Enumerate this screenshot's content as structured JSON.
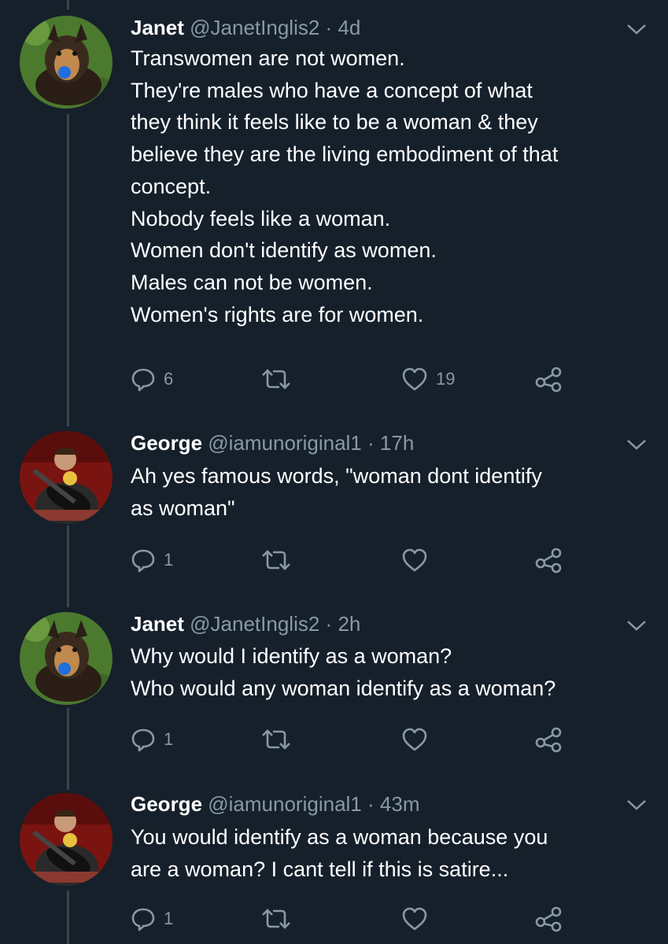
{
  "tweets": [
    {
      "name": "Janet",
      "handle": "@JanetInglis2",
      "sep": "·",
      "time": "4d",
      "lines": [
        "Transwomen are not women.",
        "They're males who have a concept of what",
        "they think it feels like to be a woman & they",
        "believe they are the living embodiment of that",
        "concept.",
        "Nobody feels like a woman.",
        "Women don't identify as women.",
        "Males can not be women.",
        "Women's rights are for women."
      ],
      "replies": "6",
      "retweets": "",
      "likes": "19"
    },
    {
      "name": "George",
      "handle": "@iamunoriginal1",
      "sep": "·",
      "time": "17h",
      "lines": [
        "Ah yes famous words, \"woman dont identify",
        "as woman\""
      ],
      "replies": "1",
      "retweets": "",
      "likes": ""
    },
    {
      "name": "Janet",
      "handle": "@JanetInglis2",
      "sep": "·",
      "time": "2h",
      "lines": [
        "Why would I identify as a woman?",
        "Who would any woman identify as a woman?"
      ],
      "replies": "1",
      "retweets": "",
      "likes": ""
    },
    {
      "name": "George",
      "handle": "@iamunoriginal1",
      "sep": "·",
      "time": "43m",
      "lines": [
        "You would identify as a woman because you",
        "are a woman? I cant tell if this is satire..."
      ],
      "replies": "1",
      "retweets": "",
      "likes": ""
    }
  ],
  "colors": {
    "background": "#15202b",
    "text": "#ffffff",
    "secondary": "#8899a6",
    "thread_line": "#38444d"
  },
  "icons": {
    "reply": "reply-icon",
    "retweet": "retweet-icon",
    "like": "heart-icon",
    "share": "share-icon",
    "menu": "chevron-down-icon"
  }
}
